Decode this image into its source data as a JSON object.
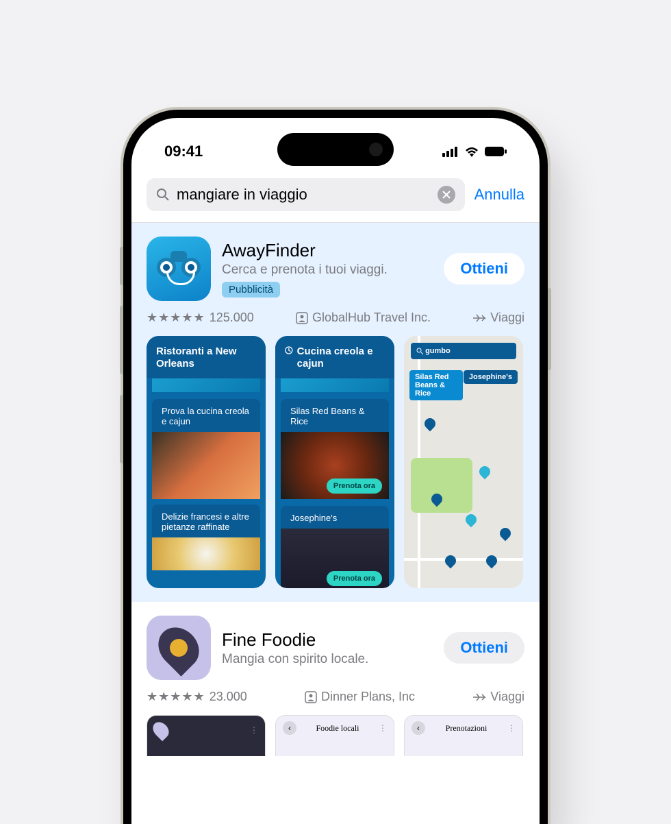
{
  "status": {
    "time": "09:41"
  },
  "search": {
    "query": "mangiare in viaggio",
    "cancel": "Annulla"
  },
  "result1": {
    "name": "AwayFinder",
    "subtitle": "Cerca e prenota i tuoi viaggi.",
    "ad_badge": "Pubblicità",
    "get": "Ottieni",
    "ratings_count": "125.000",
    "developer": "GlobalHub Travel Inc.",
    "category": "Viaggi",
    "shot1": {
      "title": "Ristoranti a New Orleans",
      "sub1": "Prova la cucina creola e cajun",
      "sub2": "Delizie francesi e altre pietanze raffinate"
    },
    "shot2": {
      "title": "Cucina creola e cajun",
      "item1": "Silas Red Beans & Rice",
      "item2": "Josephine's",
      "book": "Prenota ora"
    },
    "shot3": {
      "search": "gumbo",
      "pin1": "Silas Red Beans & Rice",
      "pin2": "Josephine's"
    }
  },
  "result2": {
    "name": "Fine Foodie",
    "subtitle": "Mangia con spirito locale.",
    "get": "Ottieni",
    "ratings_count": "23.000",
    "developer": "Dinner Plans, Inc",
    "category": "Viaggi",
    "tab1": "Foodie locali",
    "tab2": "Prenotazioni"
  }
}
